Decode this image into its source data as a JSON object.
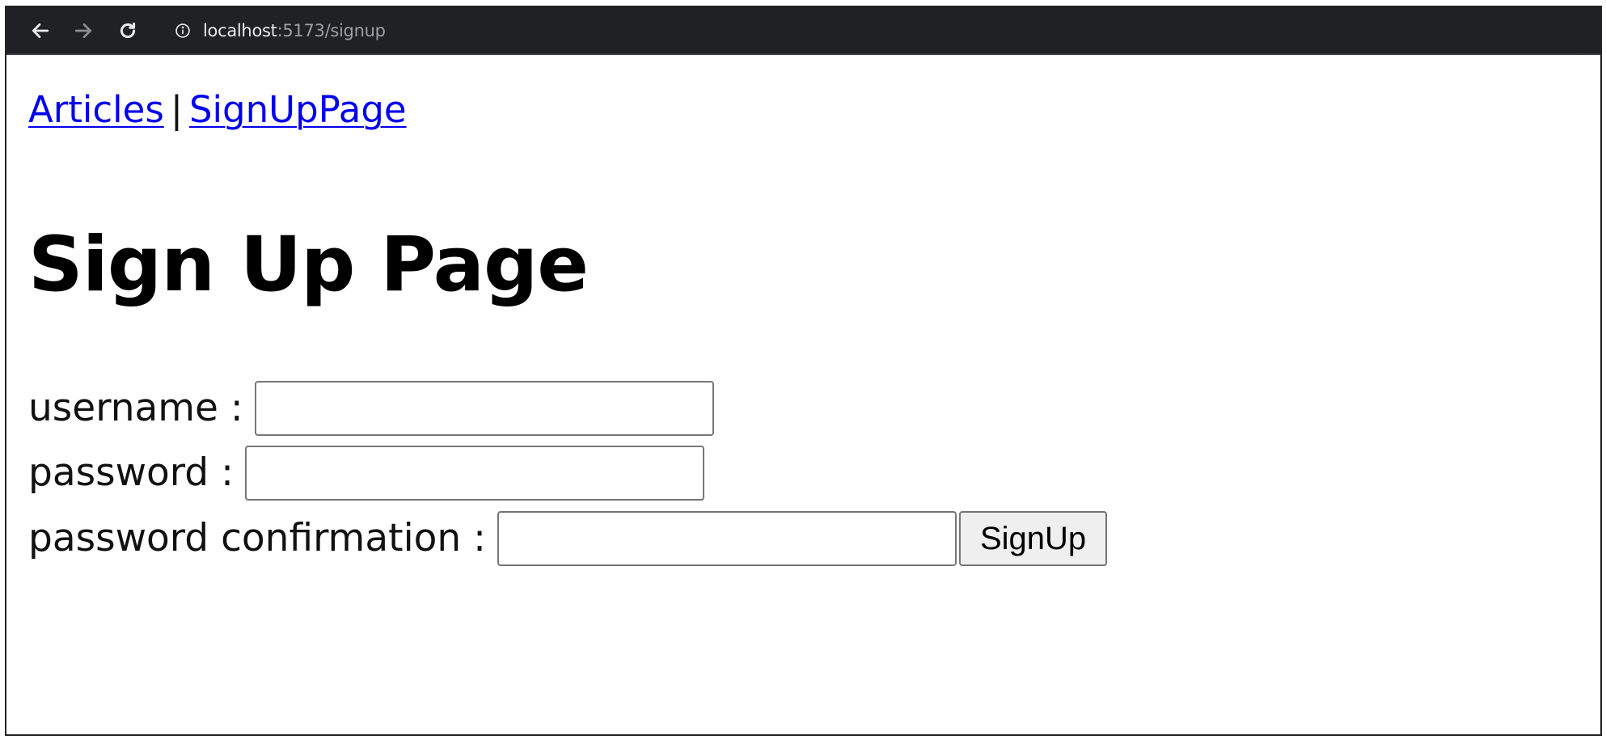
{
  "browser": {
    "url_host": "localhost",
    "url_path": ":5173/signup"
  },
  "nav": {
    "articles_link": "Articles",
    "separator": "|",
    "signup_link": "SignUpPage"
  },
  "page": {
    "title": "Sign Up Page"
  },
  "form": {
    "username_label": "username :",
    "username_value": "",
    "password_label": "password :",
    "password_value": "",
    "password_confirmation_label": "password confirmation :",
    "password_confirmation_value": "",
    "submit_label": "SignUp"
  }
}
